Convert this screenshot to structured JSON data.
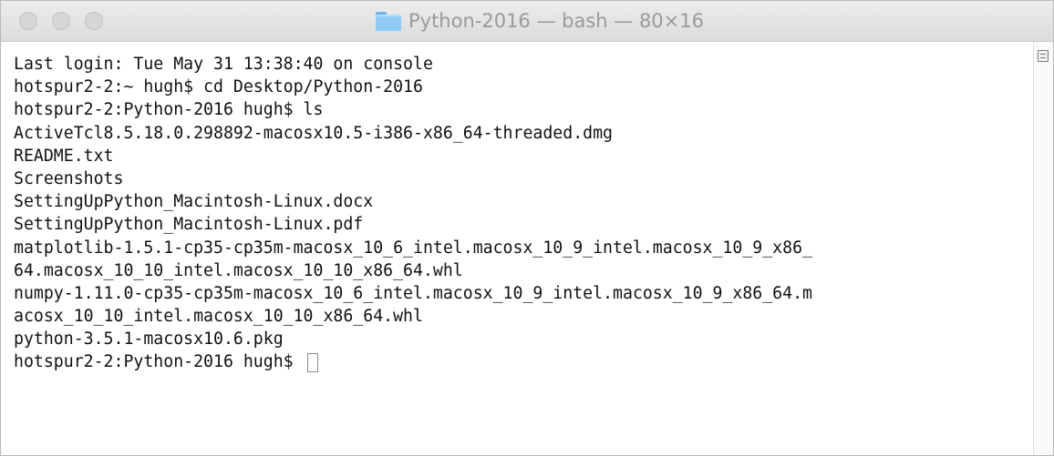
{
  "window": {
    "title": "Python-2016 — bash — 80×16",
    "folder_icon": "folder-icon"
  },
  "terminal": {
    "lines": [
      "Last login: Tue May 31 13:38:40 on console",
      "hotspur2-2:~ hugh$ cd Desktop/Python-2016",
      "hotspur2-2:Python-2016 hugh$ ls",
      "ActiveTcl8.5.18.0.298892-macosx10.5-i386-x86_64-threaded.dmg",
      "README.txt",
      "Screenshots",
      "SettingUpPython_Macintosh-Linux.docx",
      "SettingUpPython_Macintosh-Linux.pdf",
      "matplotlib-1.5.1-cp35-cp35m-macosx_10_6_intel.macosx_10_9_intel.macosx_10_9_x86_",
      "64.macosx_10_10_intel.macosx_10_10_x86_64.whl",
      "numpy-1.11.0-cp35-cp35m-macosx_10_6_intel.macosx_10_9_intel.macosx_10_9_x86_64.m",
      "acosx_10_10_intel.macosx_10_10_x86_64.whl",
      "python-3.5.1-macosx10.6.pkg"
    ],
    "prompt": "hotspur2-2:Python-2016 hugh$ "
  }
}
